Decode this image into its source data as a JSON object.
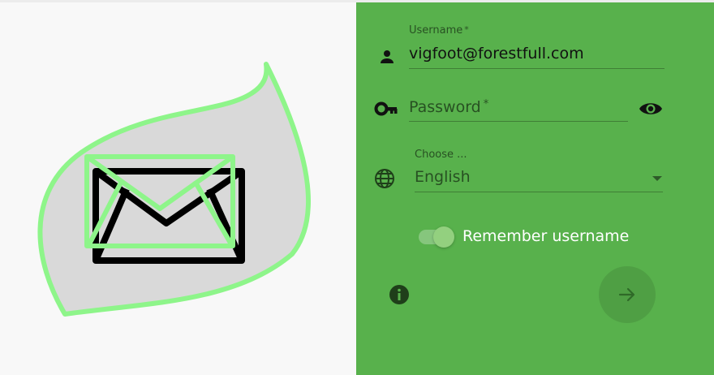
{
  "logo": {
    "icon": "mail-leaf-logo",
    "colors": {
      "leaf_fill": "#d9d9d9",
      "leaf_stroke": "#8ef58a",
      "envelope": "#000000"
    }
  },
  "form": {
    "username": {
      "label": "Username",
      "required_mark": "*",
      "value": "vigfoot@forestfull.com",
      "icon": "person-icon"
    },
    "password": {
      "placeholder": "Password",
      "required_mark": "*",
      "value": "",
      "icon": "key-icon",
      "toggle_icon": "eye-icon"
    },
    "language": {
      "label": "Choose ...",
      "value": "English",
      "icon": "globe-icon",
      "dropdown_icon": "caret-down-icon"
    },
    "remember": {
      "label": "Remember username",
      "checked": true
    },
    "info_icon": "info-icon",
    "submit_icon": "arrow-right-icon"
  },
  "colors": {
    "panel": "#58b14c",
    "background": "#f8f8f8",
    "button": "#4f9f44",
    "toggle_thumb": "#93d07f"
  }
}
